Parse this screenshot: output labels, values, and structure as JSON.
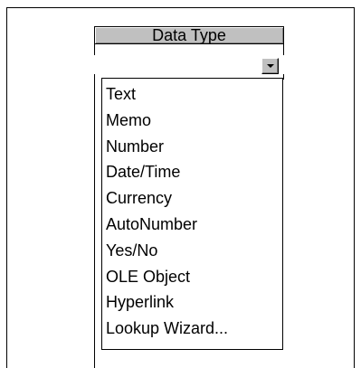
{
  "column": {
    "header": "Data Type",
    "current_value": ""
  },
  "dropdown": {
    "icon": "chevron-down-icon",
    "options": [
      "Text",
      "Memo",
      "Number",
      "Date/Time",
      "Currency",
      "AutoNumber",
      "Yes/No",
      "OLE Object",
      "Hyperlink",
      "Lookup Wizard..."
    ]
  },
  "colors": {
    "header_bg": "#c0c0c0",
    "border": "#000000",
    "background": "#ffffff"
  }
}
